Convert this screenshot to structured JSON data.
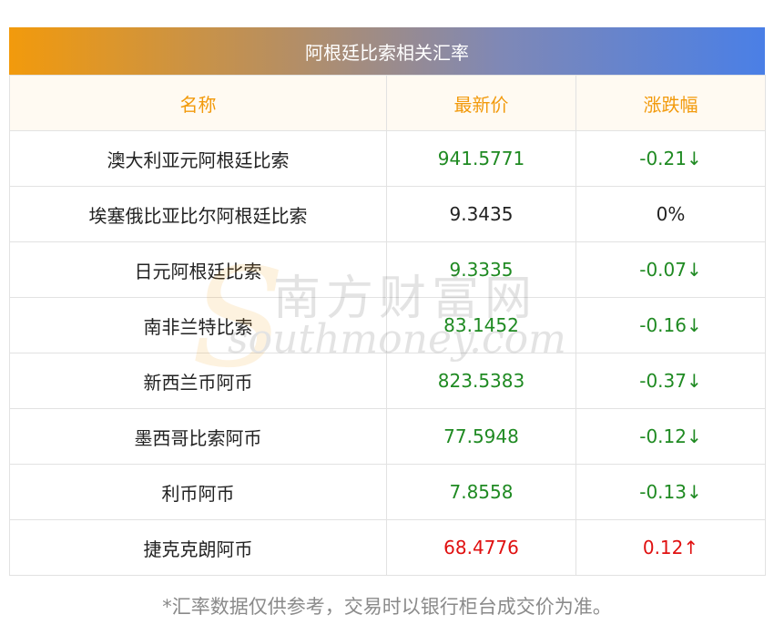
{
  "title": "阿根廷比索相关汇率",
  "columns": [
    "名称",
    "最新价",
    "涨跌幅"
  ],
  "rows": [
    {
      "name": "澳大利亚元阿根廷比索",
      "price": "941.5771",
      "change": "-0.21↓",
      "color": "green"
    },
    {
      "name": "埃塞俄比亚比尔阿根廷比索",
      "price": "9.3435",
      "change": "0%",
      "color": "black"
    },
    {
      "name": "日元阿根廷比索",
      "price": "9.3335",
      "change": "-0.07↓",
      "color": "green"
    },
    {
      "name": "南非兰特比索",
      "price": "83.1452",
      "change": "-0.16↓",
      "color": "green"
    },
    {
      "name": "新西兰币阿币",
      "price": "823.5383",
      "change": "-0.37↓",
      "color": "green"
    },
    {
      "name": "墨西哥比索阿币",
      "price": "77.5948",
      "change": "-0.12↓",
      "color": "green"
    },
    {
      "name": "利币阿币",
      "price": "7.8558",
      "change": "-0.13↓",
      "color": "green"
    },
    {
      "name": "捷克克朗阿币",
      "price": "68.4776",
      "change": "0.12↑",
      "color": "red"
    }
  ],
  "footnote": "*汇率数据仅供参考，交易时以银行柜台成交价为准。",
  "watermark": {
    "cn": "南方财富网",
    "en": "southmoney.com",
    "logo_letter": "S"
  },
  "colors": {
    "header_text": "#f29a0c",
    "down": "#1f8a22",
    "up": "#e01010",
    "title_start": "#f29a0c",
    "title_end": "#4a7fe6"
  }
}
